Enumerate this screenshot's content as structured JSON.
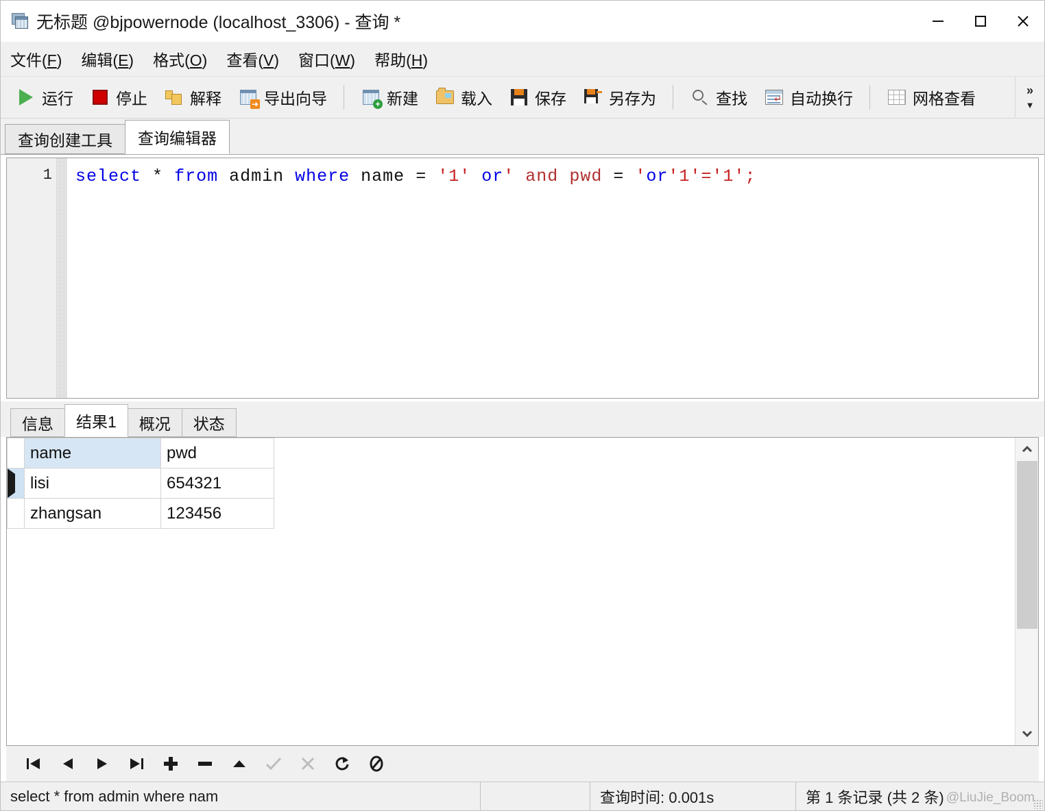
{
  "window": {
    "title": "无标题 @bjpowernode (localhost_3306) - 查询 *",
    "icon": "database-query-icon",
    "controls": {
      "minimize": "minimize-icon",
      "maximize": "maximize-icon",
      "close": "close-icon"
    }
  },
  "menubar": {
    "items": [
      {
        "text": "文件",
        "mnemonic": "F"
      },
      {
        "text": "编辑",
        "mnemonic": "E"
      },
      {
        "text": "格式",
        "mnemonic": "O"
      },
      {
        "text": "查看",
        "mnemonic": "V"
      },
      {
        "text": "窗口",
        "mnemonic": "W"
      },
      {
        "text": "帮助",
        "mnemonic": "H"
      }
    ]
  },
  "toolbar": {
    "groups": [
      [
        {
          "label": "运行",
          "icon": "play-icon"
        },
        {
          "label": "停止",
          "icon": "stop-icon"
        },
        {
          "label": "解释",
          "icon": "explain-icon"
        },
        {
          "label": "导出向导",
          "icon": "export-wizard-icon"
        }
      ],
      [
        {
          "label": "新建",
          "icon": "new-query-icon"
        },
        {
          "label": "载入",
          "icon": "open-folder-icon"
        },
        {
          "label": "保存",
          "icon": "save-icon"
        },
        {
          "label": "另存为",
          "icon": "save-as-icon"
        }
      ],
      [
        {
          "label": "查找",
          "icon": "search-icon"
        },
        {
          "label": "自动换行",
          "icon": "word-wrap-icon"
        }
      ],
      [
        {
          "label": "网格查看",
          "icon": "grid-view-icon"
        }
      ]
    ],
    "overflow": "»"
  },
  "editor_tabs": [
    {
      "label": "查询创建工具",
      "active": false
    },
    {
      "label": "查询编辑器",
      "active": true
    }
  ],
  "editor": {
    "line_number": "1",
    "sql_plain": "select * from admin where name = '1' or' and pwd = 'or'1'='1';",
    "tokens": [
      {
        "t": "select",
        "k": "kw"
      },
      {
        "t": " ",
        "k": "id"
      },
      {
        "t": "*",
        "k": "id"
      },
      {
        "t": " ",
        "k": "id"
      },
      {
        "t": "from",
        "k": "kw"
      },
      {
        "t": " ",
        "k": "id"
      },
      {
        "t": "admin",
        "k": "id"
      },
      {
        "t": " ",
        "k": "id"
      },
      {
        "t": "where",
        "k": "kw"
      },
      {
        "t": " ",
        "k": "id"
      },
      {
        "t": "name",
        "k": "id"
      },
      {
        "t": " ",
        "k": "id"
      },
      {
        "t": "=",
        "k": "id"
      },
      {
        "t": " ",
        "k": "id"
      },
      {
        "t": "'1'",
        "k": "str"
      },
      {
        "t": " ",
        "k": "id"
      },
      {
        "t": "or",
        "k": "kw"
      },
      {
        "t": "'",
        "k": "str"
      },
      {
        "t": " ",
        "k": "id"
      },
      {
        "t": "and",
        "k": "fn"
      },
      {
        "t": " ",
        "k": "id"
      },
      {
        "t": "pwd",
        "k": "fn"
      },
      {
        "t": " ",
        "k": "id"
      },
      {
        "t": "=",
        "k": "id"
      },
      {
        "t": " ",
        "k": "id"
      },
      {
        "t": "'",
        "k": "str"
      },
      {
        "t": "or",
        "k": "kw"
      },
      {
        "t": "'1'='1';",
        "k": "str"
      }
    ]
  },
  "result_tabs": [
    {
      "label": "信息",
      "active": false
    },
    {
      "label": "结果1",
      "active": true
    },
    {
      "label": "概况",
      "active": false
    },
    {
      "label": "状态",
      "active": false
    }
  ],
  "result_grid": {
    "columns": [
      "name",
      "pwd"
    ],
    "rows": [
      {
        "cells": [
          "lisi",
          "654321"
        ],
        "current": true
      },
      {
        "cells": [
          "zhangsan",
          "123456"
        ],
        "current": false
      }
    ]
  },
  "nav_toolbar": {
    "buttons": [
      {
        "name": "first-record-button",
        "glyph": "|◀",
        "disabled": false
      },
      {
        "name": "previous-record-button",
        "glyph": "◀",
        "disabled": false
      },
      {
        "name": "next-record-button",
        "glyph": "▶",
        "disabled": false
      },
      {
        "name": "last-record-button",
        "glyph": "▶|",
        "disabled": false
      },
      {
        "name": "add-record-button",
        "glyph": "＋",
        "disabled": false
      },
      {
        "name": "delete-record-button",
        "glyph": "－",
        "disabled": false
      },
      {
        "name": "move-up-button",
        "glyph": "▲",
        "disabled": false
      },
      {
        "name": "apply-changes-button",
        "glyph": "✓",
        "disabled": true
      },
      {
        "name": "cancel-changes-button",
        "glyph": "✗",
        "disabled": true
      },
      {
        "name": "refresh-button",
        "glyph": "↻",
        "disabled": false
      },
      {
        "name": "stop-loading-button",
        "glyph": "⊘",
        "disabled": false
      }
    ]
  },
  "statusbar": {
    "sql": "select * from admin where nam",
    "middle": "",
    "query_time": "查询时间: 0.001s",
    "record_info": "第 1 条记录 (共 2 条)",
    "watermark": "@LiuJie_Boom"
  },
  "colors": {
    "accent_blue": "#0000e6",
    "string_red": "#c62020",
    "chrome_gray": "#f0f0f0",
    "header_highlight": "#d6e6f4",
    "current_row": "#cfe2f3"
  }
}
